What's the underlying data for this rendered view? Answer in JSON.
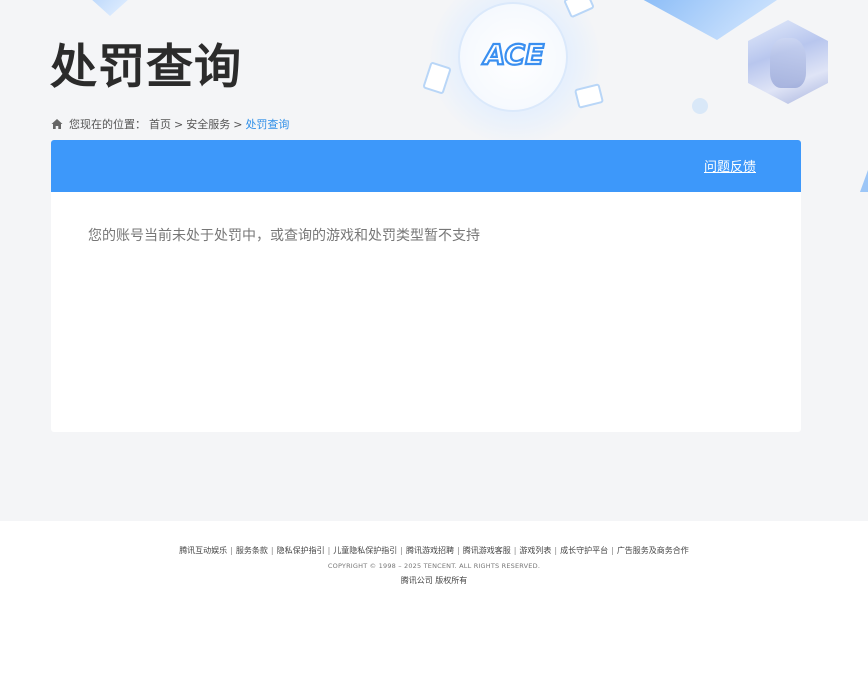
{
  "header": {
    "title": "处罚查询",
    "logo_text": "ACE"
  },
  "breadcrumb": {
    "prefix": "您现在的位置：",
    "home": "首页",
    "separator": ">",
    "section": "安全服务",
    "current": "处罚查询"
  },
  "panel": {
    "feedback_link": "问题反馈",
    "message": "您的账号当前未处于处罚中，或查询的游戏和处罚类型暂不支持"
  },
  "footer": {
    "links": [
      "腾讯互动娱乐",
      "服务条款",
      "隐私保护指引",
      "儿童隐私保护指引",
      "腾讯游戏招聘",
      "腾讯游戏客服",
      "游戏列表",
      "成长守护平台",
      "广告服务及商务合作"
    ],
    "separator": "|",
    "copyright": "COPYRIGHT © 1998 – 2025 TENCENT. ALL RIGHTS RESERVED.",
    "company": "腾讯公司 版权所有"
  },
  "colors": {
    "accent": "#3d98fa",
    "breadcrumb_current": "#2f8fe8",
    "title": "#2b2b2b"
  },
  "icons": {
    "breadcrumb": "home-icon"
  }
}
